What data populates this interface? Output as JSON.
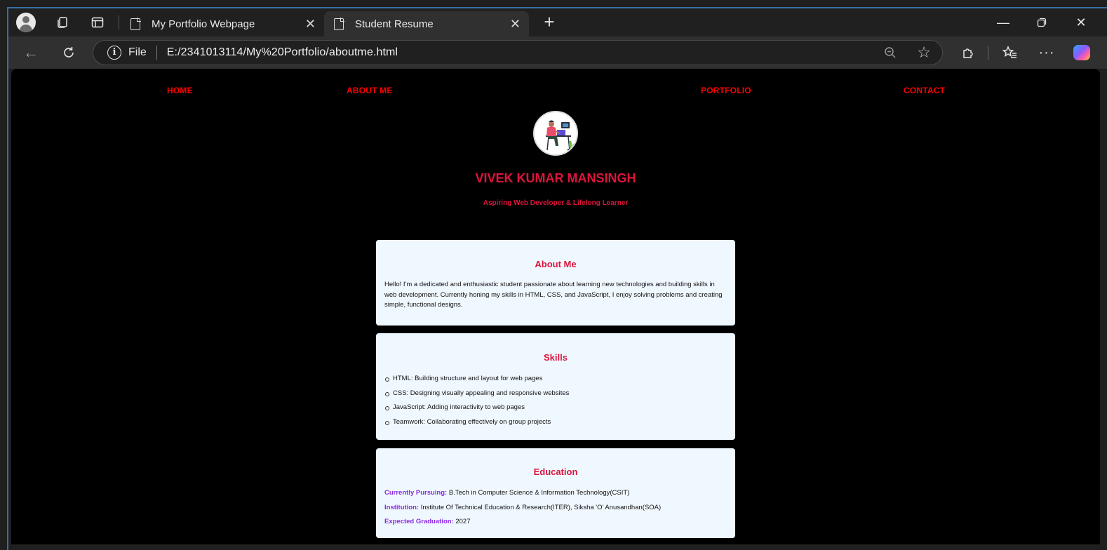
{
  "browser": {
    "tabs": [
      {
        "title": "My Portfolio Webpage",
        "active": false
      },
      {
        "title": "Student Resume",
        "active": true
      }
    ],
    "address": {
      "scheme_label": "File",
      "url": "E:/2341013114/My%20Portfolio/aboutme.html"
    },
    "icons": {
      "profile": "profile-icon",
      "workspaces": "workspaces-icon",
      "vertical_tabs": "vertical-tabs-icon",
      "new_tab": "plus-icon",
      "back": "back-arrow-icon",
      "reload": "reload-icon",
      "info": "info-icon",
      "zoom": "zoom-out-icon",
      "favorite": "star-icon",
      "extensions": "puzzle-icon",
      "favorites": "favorites-icon",
      "more": "more-icon",
      "copilot": "copilot-icon"
    }
  },
  "page": {
    "nav": [
      {
        "label": "HOME"
      },
      {
        "label": "ABOUT ME"
      },
      {
        "label": "PORTFOLIO"
      },
      {
        "label": "CONTACT"
      }
    ],
    "name": "VIVEK KUMAR MANSINGH",
    "tagline": "Aspiring Web Developer & Lifelong Learner",
    "about": {
      "heading": "About Me",
      "text": "Hello! I'm a dedicated and enthusiastic student passionate about learning new technologies and building skills in web development. Currently honing my skills in HTML, CSS, and JavaScript, I enjoy solving problems and creating simple, functional designs."
    },
    "skills": {
      "heading": "Skills",
      "items": [
        "HTML: Building structure and layout for web pages",
        "CSS: Designing visually appealing and responsive websites",
        "JavaScript: Adding interactivity to web pages",
        "Teamwork: Collaborating effectively on group projects"
      ]
    },
    "education": {
      "heading": "Education",
      "rows": [
        {
          "label": "Currently Pursuing:",
          "value": " B.Tech in Computer Science & Information Technology(CSIT)"
        },
        {
          "label": "Institution:",
          "value": " Institute Of Technical Education & Research(ITER), Siksha 'O' Anusandhan(SOA)"
        },
        {
          "label": "Expected Graduation:",
          "value": " 2027"
        }
      ]
    },
    "colors": {
      "background": "#000000",
      "nav_link": "#ff0000",
      "accent": "#dc143c",
      "card": "#f0f8ff",
      "label": "#8a2be2"
    }
  }
}
